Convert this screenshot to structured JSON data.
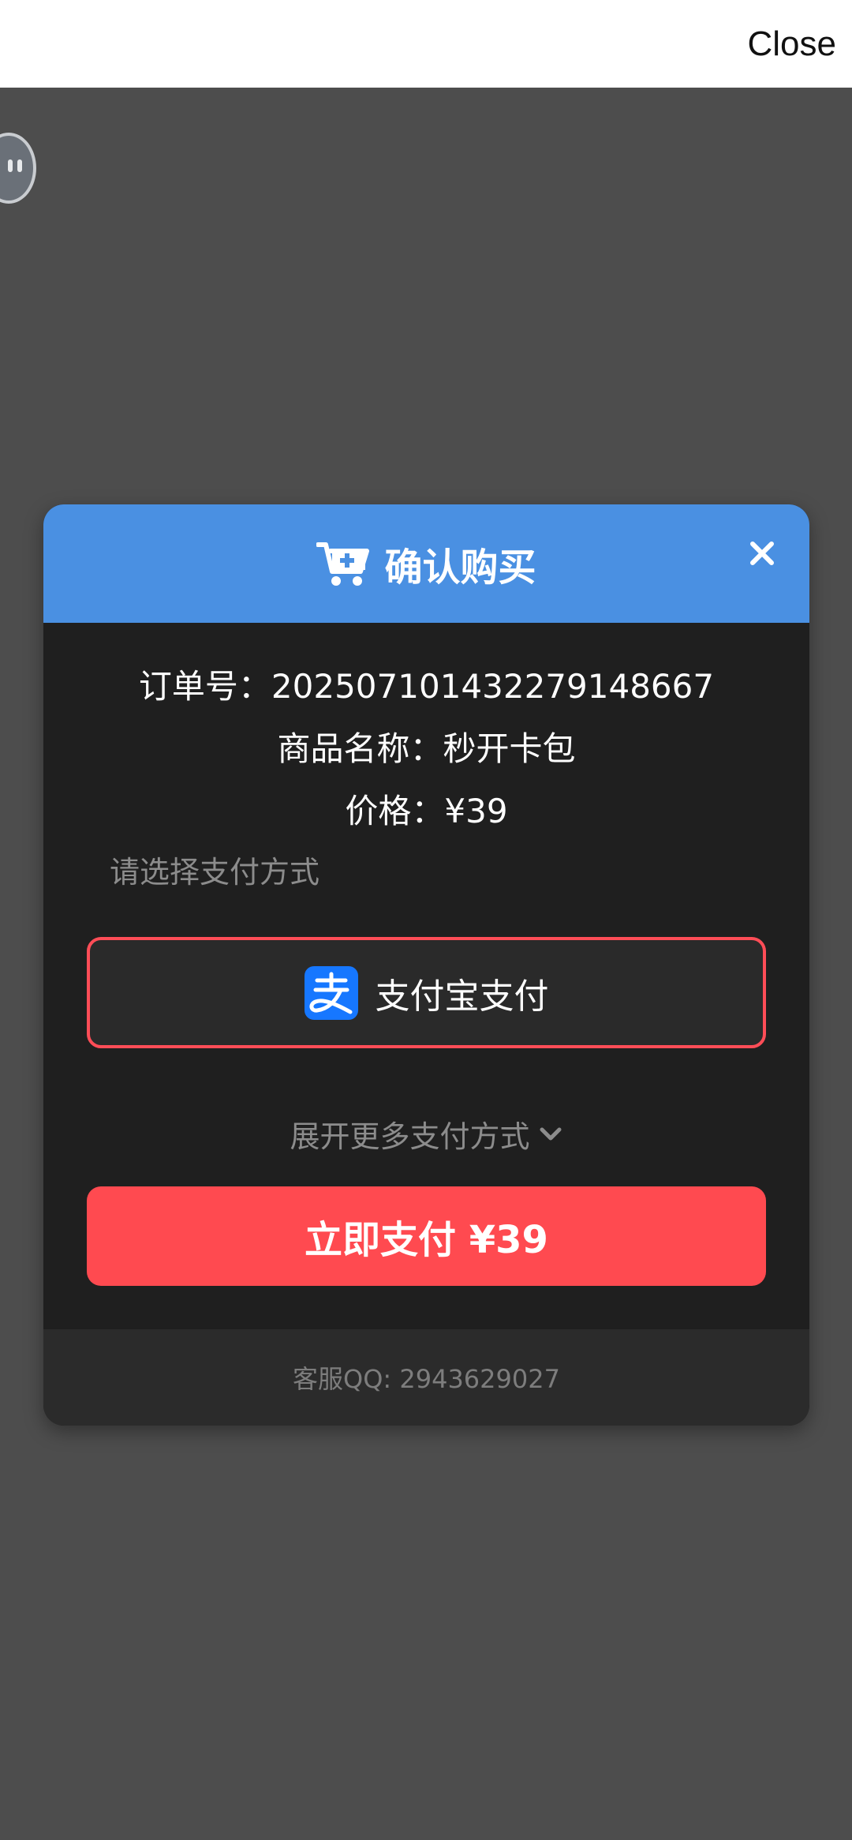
{
  "topbar": {
    "close_label": "Close"
  },
  "dialog": {
    "title": "确认购买",
    "order": {
      "label": "订单号：",
      "value": "20250710143227914​8667"
    },
    "product": {
      "label": "商品名称：",
      "value": "秒开卡包"
    },
    "price": {
      "label": "价格：",
      "value": "¥39"
    },
    "pay_hint": "请选择支付方式",
    "payment_method": {
      "label": "支付宝支付",
      "icon": "alipay-icon"
    },
    "more_methods": "展开更多支付方式",
    "pay_button": "立即支付 ¥39",
    "support": "客服QQ: 2943629027"
  },
  "colors": {
    "header": "#4a90e2",
    "accent_red": "#ff4a50",
    "dialog_bg": "#1f1f1f",
    "overlay_bg": "#4d4d4d"
  }
}
